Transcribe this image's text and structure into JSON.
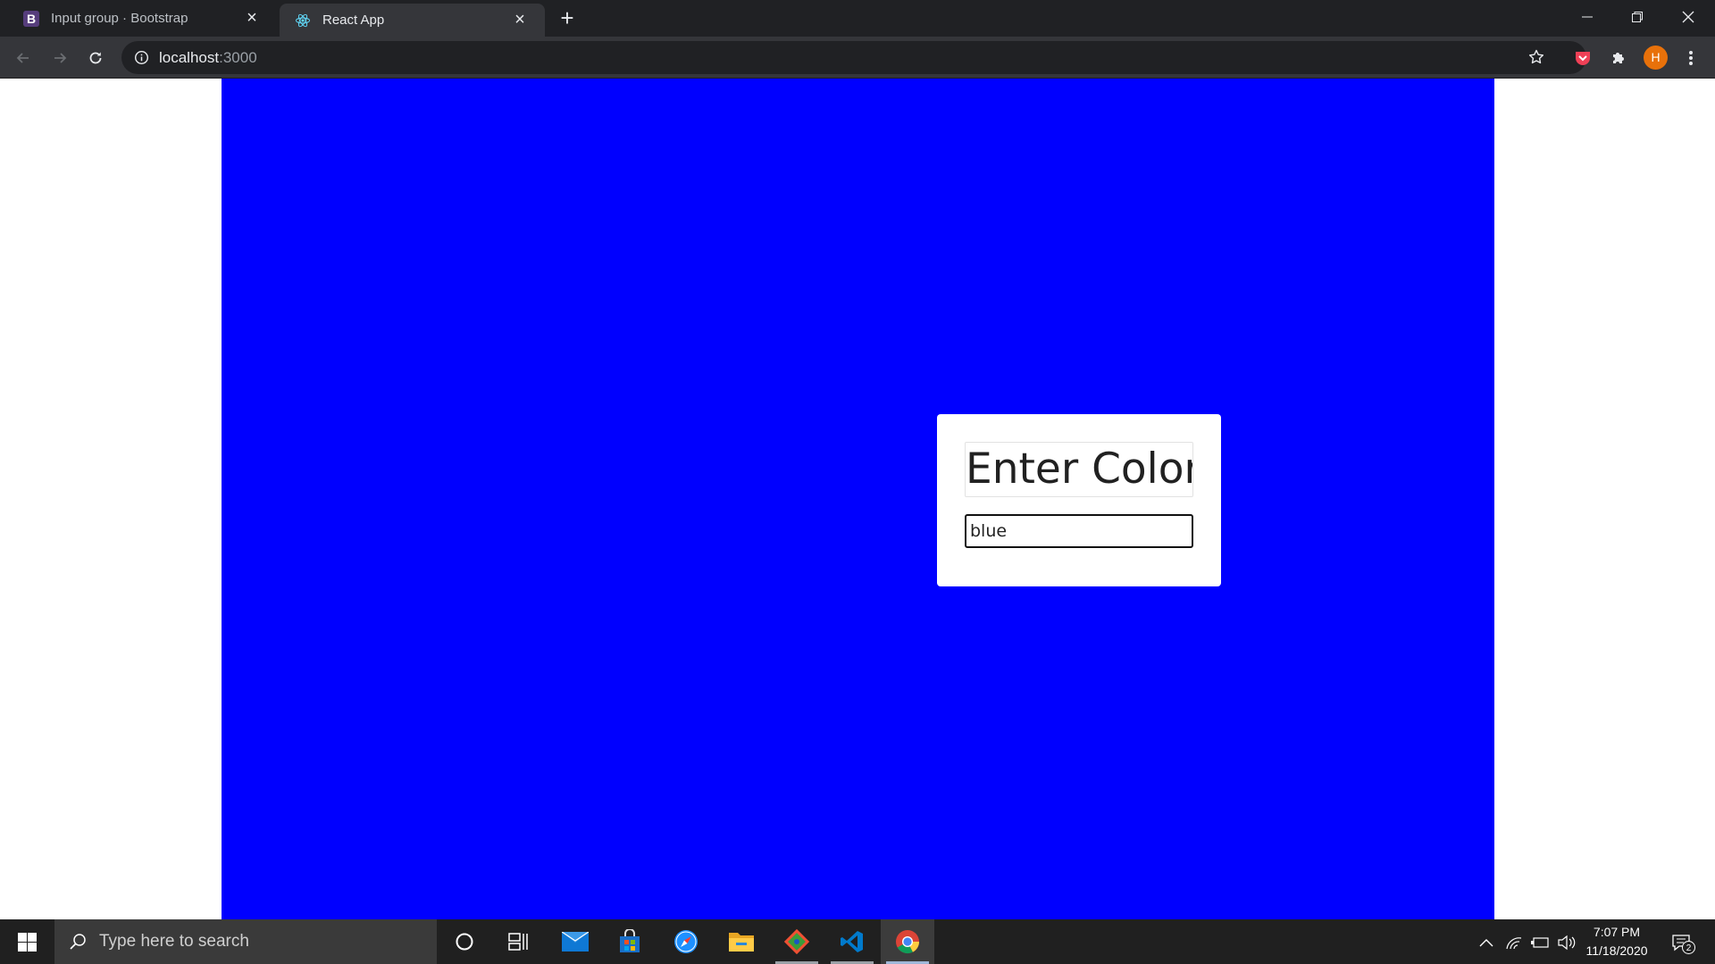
{
  "browser": {
    "tabs": [
      {
        "title": "Input group · Bootstrap",
        "favicon": "bootstrap-icon",
        "active": false
      },
      {
        "title": "React App",
        "favicon": "react-icon",
        "active": true
      }
    ],
    "address": {
      "host": "localhost",
      "port": ":3000"
    },
    "profile_initial": "H",
    "colors": {
      "profile": "#e8710a",
      "chrome_dark": "#202124",
      "chrome_toolbar": "#35363a"
    }
  },
  "app": {
    "background_color": "#0000ff",
    "title": "Enter Color",
    "input": {
      "value": "blue"
    }
  },
  "taskbar": {
    "search_placeholder": "Type here to search",
    "time": "7:07 PM",
    "date": "11/18/2020",
    "notification_count": "2",
    "pinned_apps": [
      "cortana-icon",
      "task-view-icon",
      "mail-icon",
      "store-icon",
      "safari-icon",
      "file-explorer-icon",
      "git-icon",
      "vscode-icon",
      "chrome-icon"
    ]
  }
}
